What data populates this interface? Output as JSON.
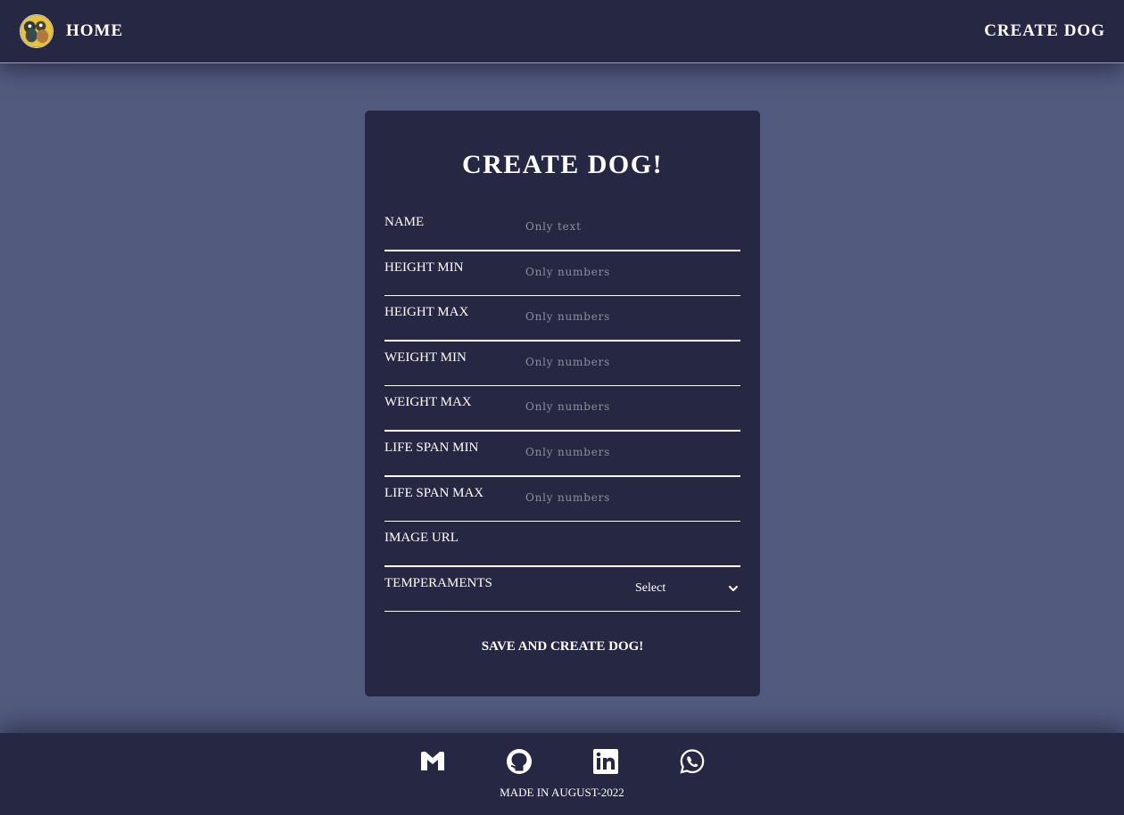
{
  "nav": {
    "home_label": "HOME",
    "create_label": "CREATE DOG"
  },
  "form": {
    "title": "CREATE DOG!",
    "fields": [
      {
        "label": "NAME",
        "placeholder": "Only text",
        "value": ""
      },
      {
        "label": "HEIGHT MIN",
        "placeholder": "Only numbers",
        "value": ""
      },
      {
        "label": "HEIGHT MAX",
        "placeholder": "Only numbers",
        "value": ""
      },
      {
        "label": "WEIGHT MIN",
        "placeholder": "Only numbers",
        "value": ""
      },
      {
        "label": "WEIGHT MAX",
        "placeholder": "Only numbers",
        "value": ""
      },
      {
        "label": "LIFE SPAN MIN",
        "placeholder": "Only numbers",
        "value": ""
      },
      {
        "label": "LIFE SPAN MAX",
        "placeholder": "Only numbers",
        "value": ""
      },
      {
        "label": "IMAGE URL",
        "placeholder": "",
        "value": ""
      }
    ],
    "temperaments_label": "TEMPERAMENTS",
    "temperaments_selected": "Select",
    "submit_label": "SAVE AND CREATE DOG!"
  },
  "footer": {
    "icons": [
      "gmail-icon",
      "github-icon",
      "linkedin-icon",
      "whatsapp-icon"
    ],
    "made_in": "MADE IN AUGUST-2022"
  },
  "colors": {
    "page_bg": "#525a7e",
    "panel_bg": "#262742",
    "text": "#ffffff",
    "placeholder": "#8d8ea0"
  }
}
